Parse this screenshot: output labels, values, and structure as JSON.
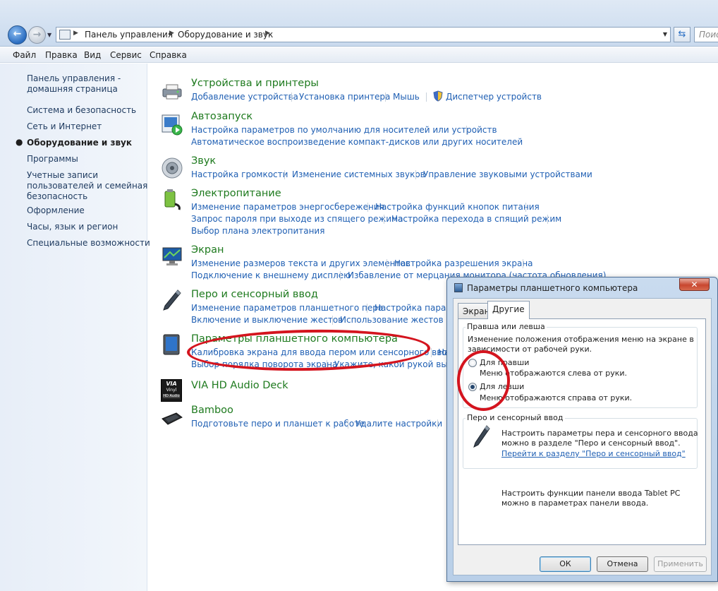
{
  "addressbar": {
    "crumbs": [
      "Панель управления",
      "Оборудование и звук"
    ],
    "search_placeholder": "Поис"
  },
  "menubar": [
    "Файл",
    "Правка",
    "Вид",
    "Сервис",
    "Справка"
  ],
  "leftnav": {
    "home": [
      "Панель управления -",
      "домашняя страница"
    ],
    "items": [
      "Система и безопасность",
      "Сеть и Интернет",
      "Оборудование и звук",
      "Программы"
    ],
    "accounts": [
      "Учетные записи",
      "пользователей и семейная",
      "безопасность"
    ],
    "items2": [
      "Оформление",
      "Часы, язык и регион",
      "Специальные возможности"
    ],
    "active": "Оборудование и звук"
  },
  "categories": {
    "devices": {
      "title": "Устройства и принтеры",
      "links": [
        "Добавление устройства",
        "Установка принтера",
        "Мышь",
        "Диспетчер устройств"
      ]
    },
    "autoplay": {
      "title": "Автозапуск",
      "links": [
        "Настройка параметров по умолчанию для носителей или устройств",
        "Автоматическое воспроизведение компакт-дисков или других носителей"
      ]
    },
    "sound": {
      "title": "Звук",
      "links": [
        "Настройка громкости",
        "Изменение системных звуков",
        "Управление звуковыми устройствами"
      ]
    },
    "power": {
      "title": "Электропитание",
      "links": [
        "Изменение параметров энергосбережения",
        "Настройка функций кнопок питания",
        "Запрос пароля при выходе из спящего режима",
        "Настройка перехода в спящий режим",
        "Выбор плана электропитания"
      ]
    },
    "display": {
      "title": "Экран",
      "links": [
        "Изменение размеров текста и других элементов",
        "Настройка разрешения экрана",
        "Подключение к внешнему дисплею",
        "Избавление от мерцания монитора (частота обновления)"
      ]
    },
    "pen": {
      "title": "Перо и сенсорный ввод",
      "links": [
        "Изменение параметров планшетного пера",
        "Настройка параме",
        "Включение и выключение жестов",
        "Использование жестов для"
      ]
    },
    "tablet": {
      "title": "Параметры планшетного компьютера",
      "links": [
        "Калибровка экрана для ввода пером или сенсорного ввода",
        "На",
        "Выбор порядка поворота экрана",
        "Укажите, какой рукой вы пиш"
      ]
    },
    "via": {
      "title": "VIA HD Audio Deck",
      "icon_text": [
        "VIA",
        "Vinyl",
        "HD Audio"
      ]
    },
    "bamboo": {
      "title": "Bamboo",
      "links": [
        "Подготовьте перо и планшет к работе",
        "Удалите настройки"
      ]
    }
  },
  "dialog": {
    "title": "Параметры планшетного компьютера",
    "close": "✕",
    "tabs": [
      "Экран",
      "Другие"
    ],
    "active_tab": "Другие",
    "handedness": {
      "label": "Правша или левша",
      "desc": [
        "Изменение положения отображения меню на экране в",
        "зависимости от рабочей руки."
      ],
      "right": {
        "label": "Для правши",
        "desc": "Меню отображаются слева от руки."
      },
      "left": {
        "label": "Для левши",
        "desc": "Меню отображаются справа от руки."
      },
      "selected": "Для левши"
    },
    "pen": {
      "label": "Перо и сенсорный ввод",
      "desc": [
        "Настроить параметры пера и сенсорного ввода",
        "можно в разделе \"Перо и сенсорный ввод\"."
      ],
      "link": "Перейти к разделу \"Перо и сенсорный ввод\""
    },
    "tabletpc": [
      "Настроить функции панели ввода Tablet PC",
      "можно в параметрах панели ввода."
    ],
    "buttons": {
      "ok": "ОК",
      "cancel": "Отмена",
      "apply": "Применить"
    }
  },
  "colors": {
    "link": "#1f5fb3",
    "category_title": "#1e7a1e",
    "annotation": "#d4141e"
  }
}
